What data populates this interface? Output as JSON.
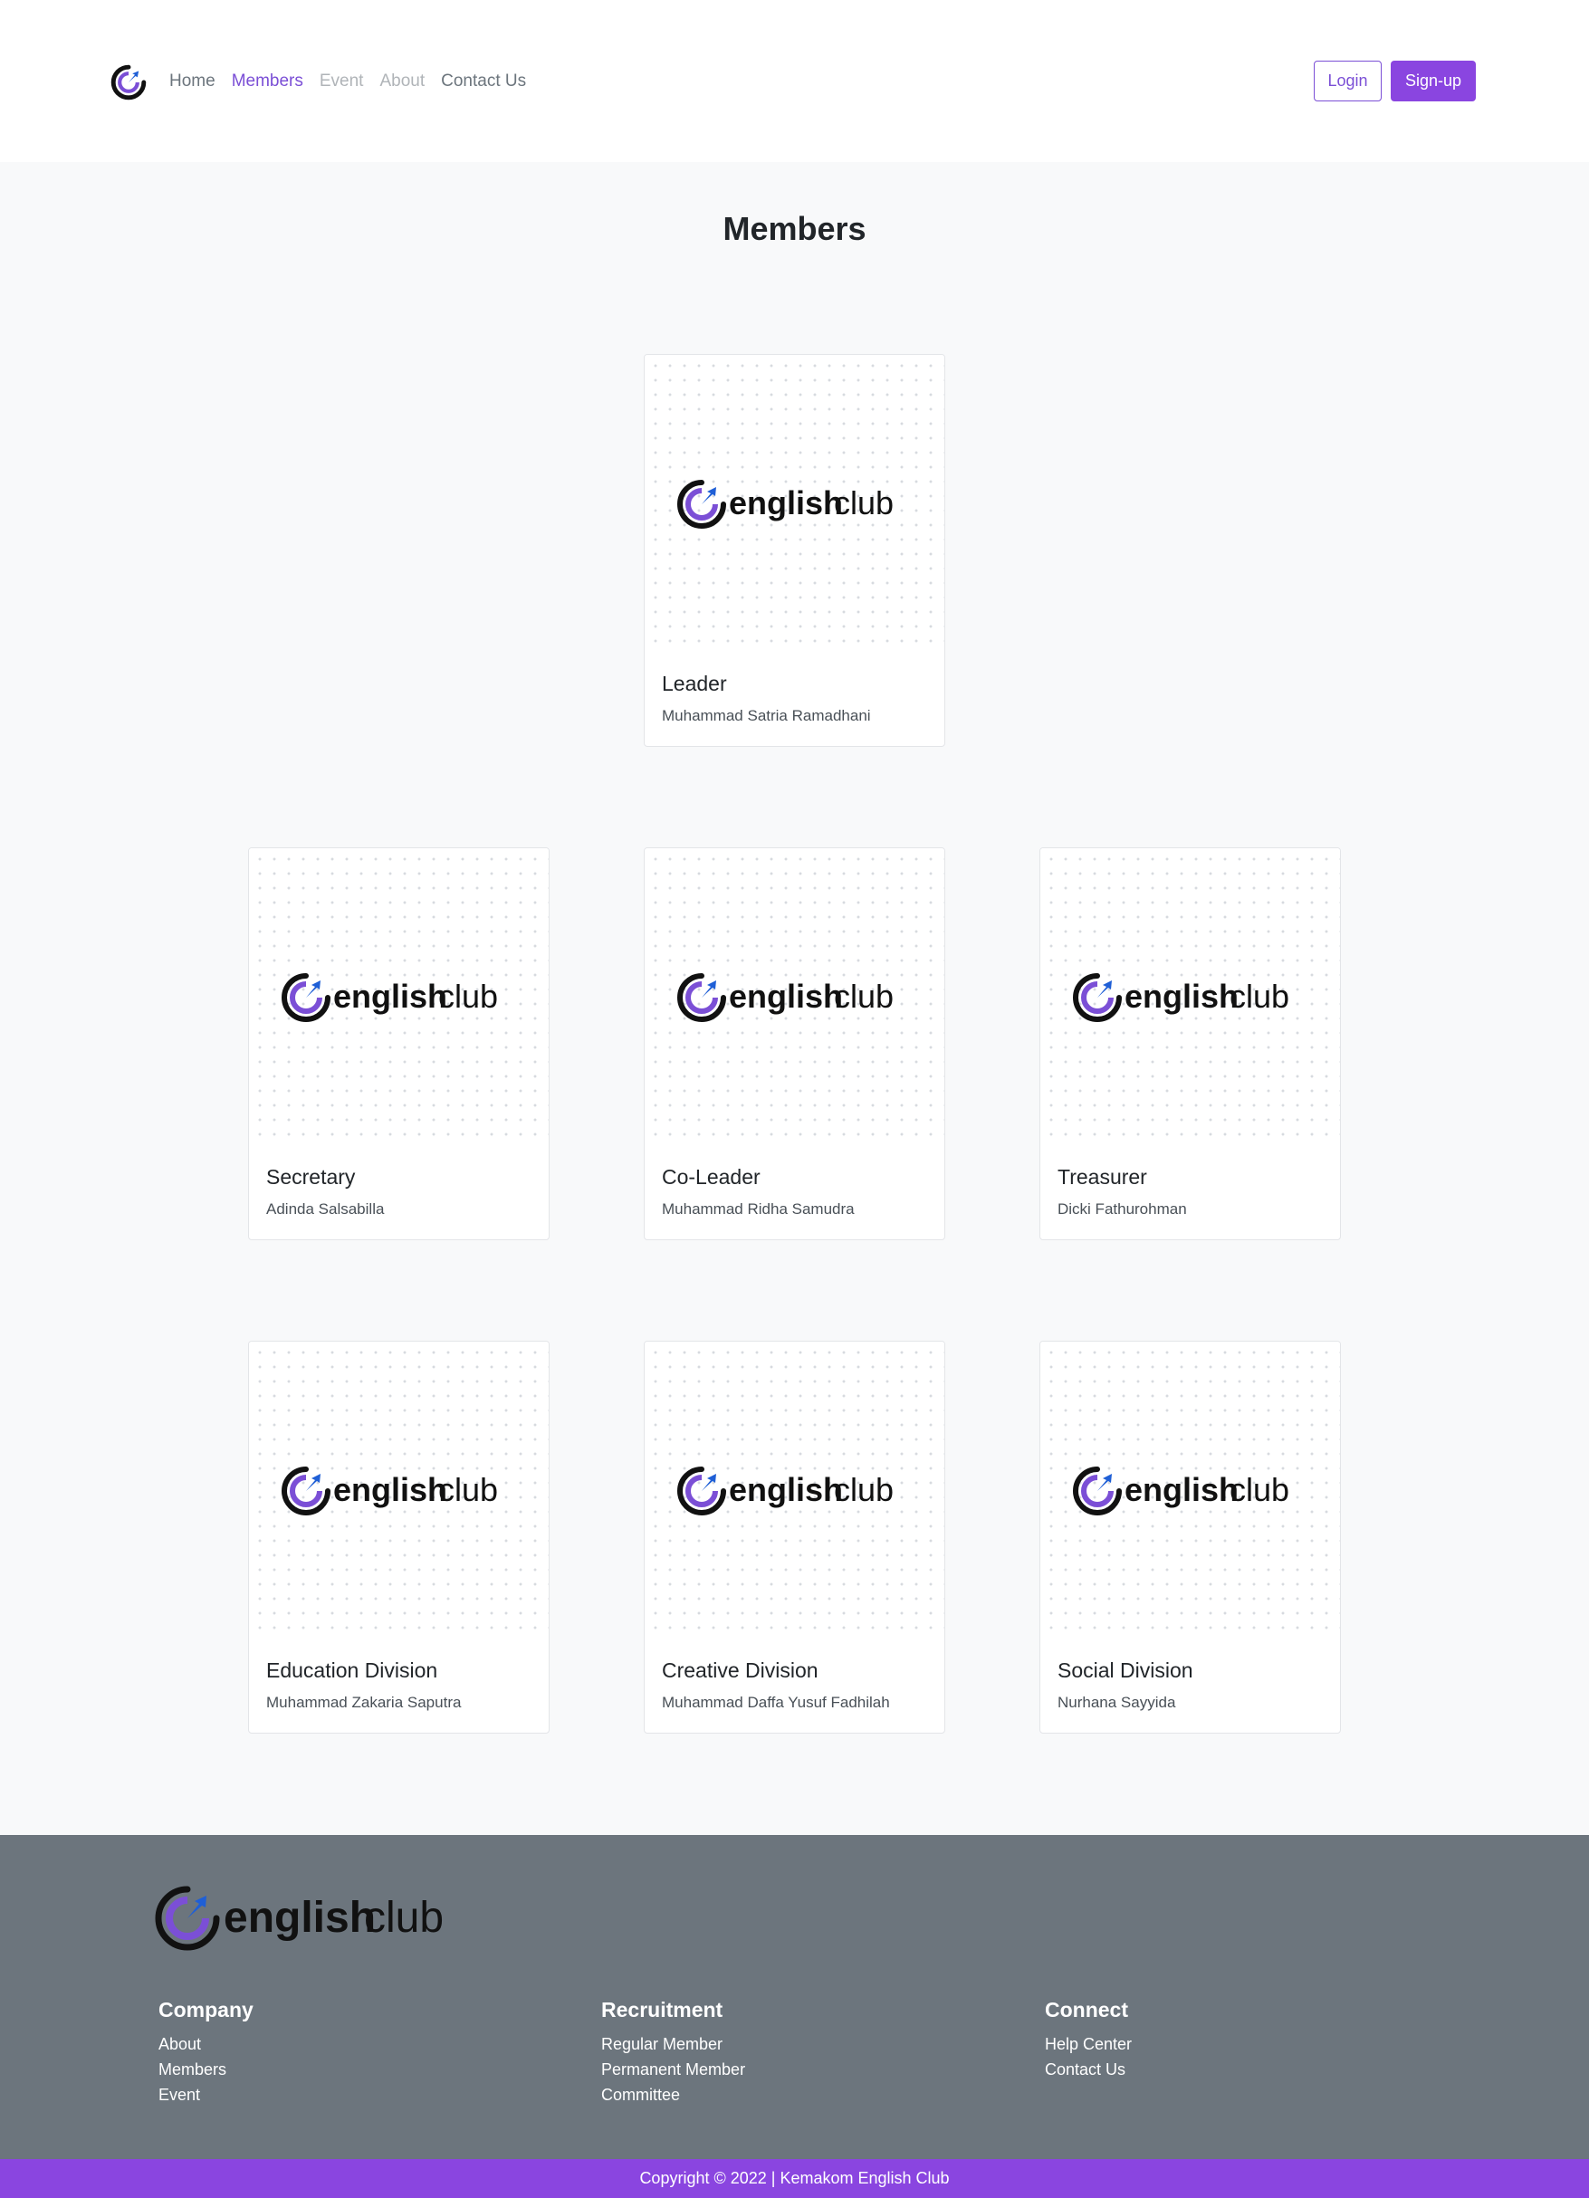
{
  "nav": {
    "logo_icon": "englishclub-c-icon",
    "links": [
      {
        "label": "Home",
        "state": "normal"
      },
      {
        "label": "Members",
        "state": "active"
      },
      {
        "label": "Event",
        "state": "disabled"
      },
      {
        "label": "About",
        "state": "disabled"
      },
      {
        "label": "Contact Us",
        "state": "normal"
      }
    ],
    "login_label": "Login",
    "signup_label": "Sign-up"
  },
  "main": {
    "title": "Members",
    "members": [
      {
        "role": "Leader",
        "name": "Muhammad Satria Ramadhani"
      },
      {
        "role": "Secretary",
        "name": "Adinda Salsabilla"
      },
      {
        "role": "Co-Leader",
        "name": "Muhammad Ridha Samudra"
      },
      {
        "role": "Treasurer",
        "name": "Dicki Fathurohman"
      },
      {
        "role": "Education Division",
        "name": "Muhammad Zakaria Saputra"
      },
      {
        "role": "Creative Division",
        "name": "Muhammad Daffa Yusuf Fadhilah"
      },
      {
        "role": "Social Division",
        "name": "Nurhana Sayyida"
      }
    ]
  },
  "logo": {
    "word_bold": "english",
    "word_light": "club"
  },
  "footer": {
    "columns": [
      {
        "heading": "Company",
        "links": [
          "About",
          "Members",
          "Event"
        ]
      },
      {
        "heading": "Recruitment",
        "links": [
          "Regular Member",
          "Permanent Member",
          "Committee"
        ]
      },
      {
        "heading": "Connect",
        "links": [
          "Help Center",
          "Contact Us"
        ]
      }
    ],
    "copyright": "Copyright © 2022 | Kemakom English Club"
  },
  "colors": {
    "brand_purple": "#8a45e0",
    "footer_gray": "#6c757d",
    "logo_blue": "#1f5fd6"
  }
}
